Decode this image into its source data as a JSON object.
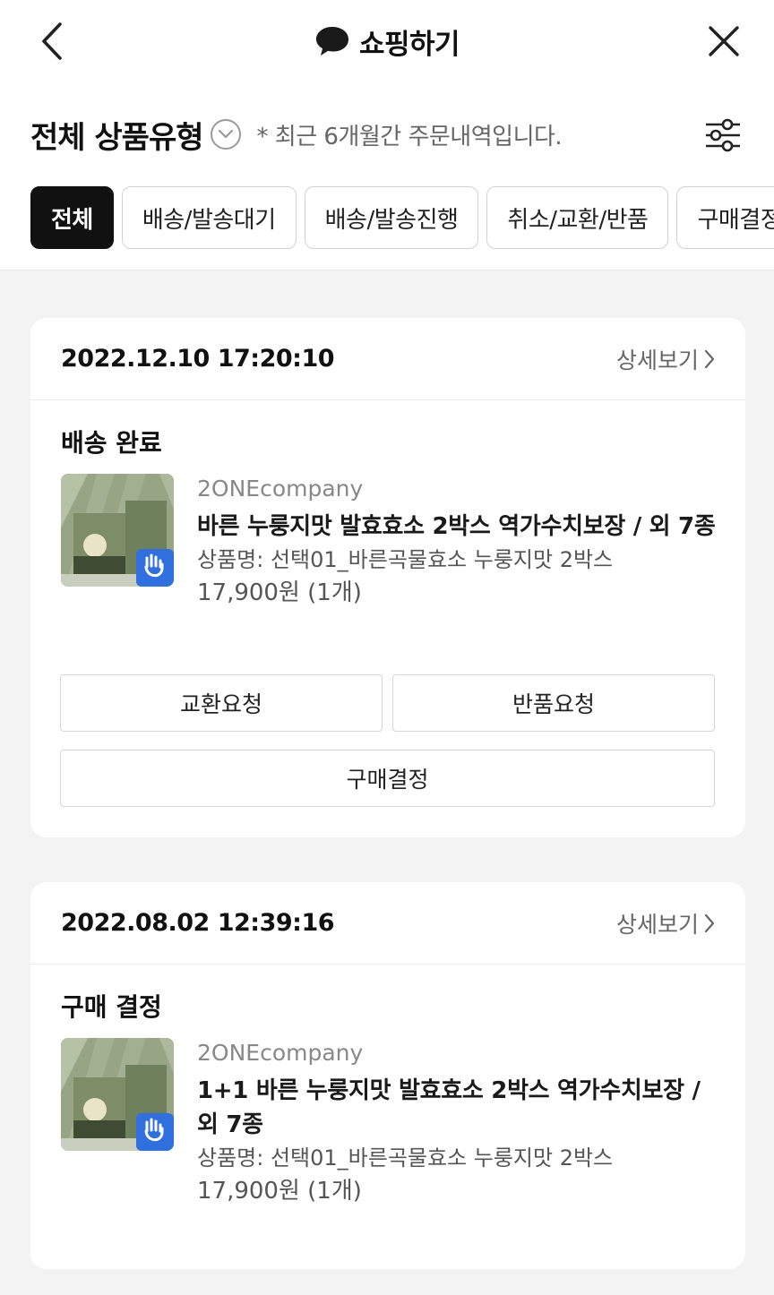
{
  "header": {
    "title": "쇼핑하기",
    "back_icon": "chevron-left-icon",
    "close_icon": "close-icon",
    "brand_icon": "chat-bubble-icon"
  },
  "filter": {
    "type_label": "전체 상품유형",
    "note": "* 최근 6개월간 주문내역입니다.",
    "settings_icon": "sliders-icon"
  },
  "tabs": [
    {
      "label": "전체",
      "active": true
    },
    {
      "label": "배송/발송대기",
      "active": false
    },
    {
      "label": "배송/발송진행",
      "active": false
    },
    {
      "label": "취소/교환/반품",
      "active": false
    },
    {
      "label": "구매결정",
      "active": false
    }
  ],
  "orders": [
    {
      "date": "2022.12.10 17:20:10",
      "detail_label": "상세보기",
      "status": "배송 완료",
      "seller": "2ONEcompany",
      "product_name": "바른 누룽지맛 발효효소 2박스 역가수치보장 / 외 7종",
      "option": "상품명: 선택01_바른곡물효소 누룽지맛 2박스",
      "price": "17,900원 (1개)",
      "buttons": [
        "교환요청",
        "반품요청",
        "구매결정"
      ]
    },
    {
      "date": "2022.08.02 12:39:16",
      "detail_label": "상세보기",
      "status": "구매 결정",
      "seller": "2ONEcompany",
      "product_name": "1+1 바른 누룽지맛 발효효소 2박스 역가수치보장 / 외 7종",
      "option": "상품명: 선택01_바른곡물효소 누룽지맛 2박스",
      "price": "17,900원 (1개)"
    }
  ],
  "colors": {
    "accent_dark": "#111111",
    "badge_blue": "#2f6fde",
    "product_green": "#7f9070"
  }
}
